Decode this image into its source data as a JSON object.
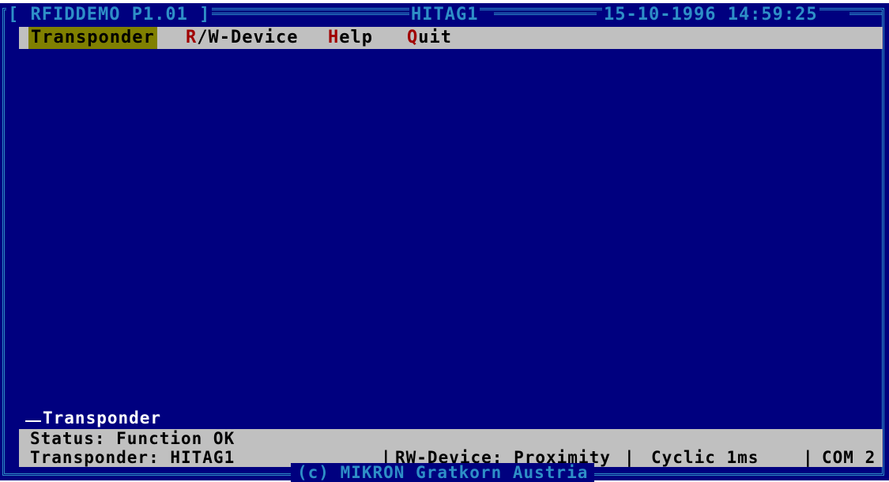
{
  "window": {
    "app_title": "[ RFIDDEMO P1.01 ]",
    "device_title": "HITAG1",
    "datetime": "15-10-1996 14:59:25"
  },
  "menu": {
    "items": [
      {
        "hotkey": "T",
        "rest": "ransponder",
        "selected": true
      },
      {
        "hotkey": "R",
        "rest": "/W-Device",
        "selected": false
      },
      {
        "hotkey": "H",
        "rest": "elp",
        "selected": false
      },
      {
        "hotkey": "Q",
        "rest": "uit",
        "selected": false
      }
    ]
  },
  "panel": {
    "label": "Transponder"
  },
  "status": {
    "line1": "Status: Function OK",
    "transponder": "Transponder: HITAG1",
    "rw_device": "RW-Device: Proximity",
    "cyclic": "Cyclic 1ms",
    "port": "COM 2"
  },
  "footer": {
    "copyright": "(c) MIKRON Gratkorn Austria"
  },
  "colors": {
    "background": "#00007f",
    "frame": "#2e8fc7",
    "bar": "#c0c0c0",
    "selected": "#808000",
    "hotkey": "#a00000"
  }
}
